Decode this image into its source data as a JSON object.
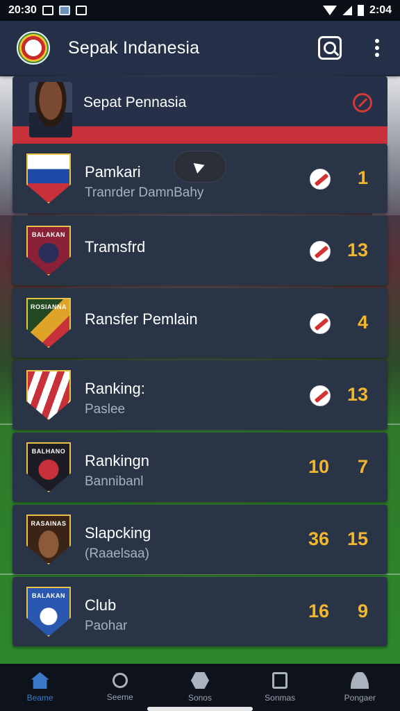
{
  "status": {
    "time": "20:30",
    "right_text": "2:04"
  },
  "appbar": {
    "title": "Sepak Indanesia",
    "logo_icon": "club-logo",
    "search_icon": "search-icon",
    "more_icon": "more-vertical-icon"
  },
  "feature": {
    "title": "Sepat Pennasia",
    "accent": "#c8303a"
  },
  "rows": [
    {
      "title": "Pamkari",
      "subtitle": "Tranrder DamnBahy",
      "crest_text": "",
      "crest_color": "#1f4aa8",
      "num_a": "",
      "num_b": "1",
      "icon": "flag-icon"
    },
    {
      "title": "Tramsfrd",
      "subtitle": "",
      "crest_text": "BALAKAN",
      "crest_color": "#8a2136",
      "num_a": "",
      "num_b": "13",
      "icon": "flag-icon"
    },
    {
      "title": "Ransfer Pemlain",
      "subtitle": "",
      "crest_text": "ROSIANNA",
      "crest_color": "#234a22",
      "num_a": "",
      "num_b": "4",
      "icon": "flag-icon"
    },
    {
      "title": "Ranking:",
      "subtitle": "Paslee",
      "crest_text": "",
      "crest_color": "#c8303a",
      "num_a": "",
      "num_b": "13",
      "icon": "flag-icon"
    },
    {
      "title": "Rankingn",
      "subtitle": "Bannibanl",
      "crest_text": "BALHANO",
      "crest_color": "#1c1c24",
      "num_a": "10",
      "num_b": "7",
      "icon": ""
    },
    {
      "title": "Slapcking",
      "subtitle": "(Raaelsaa)",
      "crest_text": "RASAINAS",
      "crest_color": "#3a2418",
      "num_a": "36",
      "num_b": "15",
      "icon": ""
    },
    {
      "title": "Club",
      "subtitle": "Paohar",
      "crest_text": "BALAKAN",
      "crest_color": "#2a58b0",
      "num_a": "16",
      "num_b": "9",
      "icon": ""
    }
  ],
  "nav": [
    {
      "label": "Beame",
      "icon": "home-icon"
    },
    {
      "label": "Seeme",
      "icon": "search-icon"
    },
    {
      "label": "Sonos",
      "icon": "hexagon-icon"
    },
    {
      "label": "Sonmas",
      "icon": "document-icon"
    },
    {
      "label": "Pongaer",
      "icon": "user-icon"
    }
  ],
  "colors": {
    "accent": "#f2b630",
    "nav_active": "#3d79c9",
    "card": "#2a3447"
  }
}
